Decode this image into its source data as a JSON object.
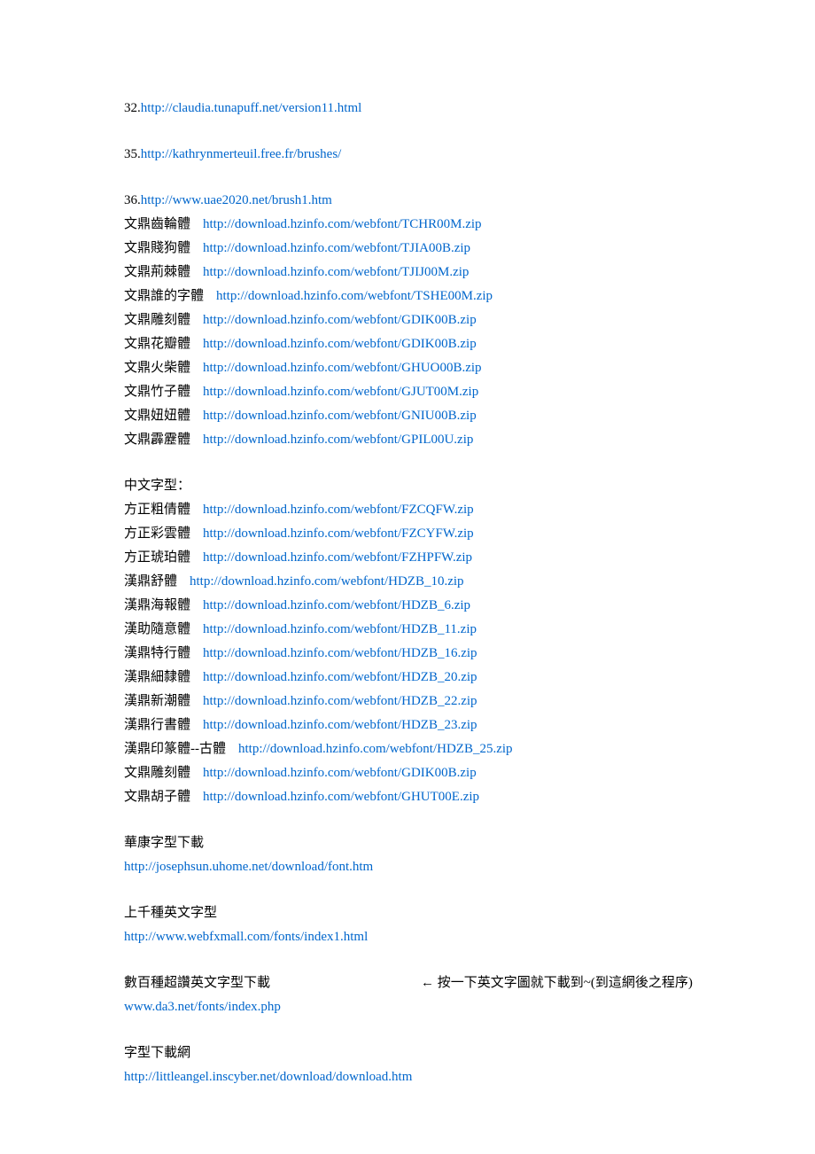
{
  "lines": {
    "l32_num": "32.",
    "l32_url": "http://claudia.tunapuff.net/version11.html",
    "l35_num": "35.",
    "l35_url": "http://kathrynmerteuil.free.fr/brushes/",
    "l36_num": "36.",
    "l36_url": "http://www.uae2020.net/brush1.htm",
    "f01_label": "文鼎齒輪體",
    "f01_url": "http://download.hzinfo.com/webfont/TCHR00M.zip",
    "f02_label": "文鼎賤狗體",
    "f02_url": "http://download.hzinfo.com/webfont/TJIA00B.zip",
    "f03_label": "文鼎荊棘體",
    "f03_url": "http://download.hzinfo.com/webfont/TJIJ00M.zip",
    "f04_label": "文鼎誰的字體",
    "f04_url": "http://download.hzinfo.com/webfont/TSHE00M.zip",
    "f05_label": "文鼎雕刻體",
    "f05_url": "http://download.hzinfo.com/webfont/GDIK00B.zip",
    "f06_label": "文鼎花瓣體",
    "f06_url": "http://download.hzinfo.com/webfont/GDIK00B.zip",
    "f07_label": "文鼎火柴體",
    "f07_url": "http://download.hzinfo.com/webfont/GHUO00B.zip",
    "f08_label": "文鼎竹子體",
    "f08_url": "http://download.hzinfo.com/webfont/GJUT00M.zip",
    "f09_label": "文鼎妞妞體",
    "f09_url": "http://download.hzinfo.com/webfont/GNIU00B.zip",
    "f10_label": "文鼎霹靂體",
    "f10_url": "http://download.hzinfo.com/webfont/GPIL00U.zip",
    "sec2_title": "中文字型：",
    "g01_label": "方正粗倩體",
    "g01_url": "http://download.hzinfo.com/webfont/FZCQFW.zip",
    "g02_label": "方正彩雲體",
    "g02_url": "http://download.hzinfo.com/webfont/FZCYFW.zip",
    "g03_label": "方正琥珀體",
    "g03_url": "http://download.hzinfo.com/webfont/FZHPFW.zip",
    "g04_label": "漢鼎舒體",
    "g04_url": "http://download.hzinfo.com/webfont/HDZB_10.zip",
    "g05_label": "漢鼎海報體",
    "g05_url": "http://download.hzinfo.com/webfont/HDZB_6.zip",
    "g06_label": "漢助隨意體",
    "g06_url": "http://download.hzinfo.com/webfont/HDZB_11.zip",
    "g07_label": "漢鼎特行體",
    "g07_url": "http://download.hzinfo.com/webfont/HDZB_16.zip",
    "g08_label": "漢鼎細隸體",
    "g08_url": "http://download.hzinfo.com/webfont/HDZB_20.zip",
    "g09_label": "漢鼎新潮體",
    "g09_url": "http://download.hzinfo.com/webfont/HDZB_22.zip",
    "g10_label": "漢鼎行書體",
    "g10_url": "http://download.hzinfo.com/webfont/HDZB_23.zip",
    "g11_label": "漢鼎印篆體--古體",
    "g11_url": "http://download.hzinfo.com/webfont/HDZB_25.zip",
    "g12_label": "文鼎雕刻體",
    "g12_url": "http://download.hzinfo.com/webfont/GDIK00B.zip",
    "g13_label": "文鼎胡子體",
    "g13_url": "http://download.hzinfo.com/webfont/GHUT00E.zip",
    "sec3_title": "華康字型下載",
    "sec3_url": "http://josephsun.uhome.net/download/font.htm",
    "sec4_title": "上千種英文字型",
    "sec4_url": "http://www.webfxmall.com/fonts/index1.html",
    "sec5_title": "數百種超讚英文字型下載",
    "sec5_note": "← 按一下英文字圖就下載到~(到這網後之程序)",
    "sec5_url": "www.da3.net/fonts/index.php",
    "sec6_title": "字型下載網",
    "sec6_url": "http://littleangel.inscyber.net/download/download.htm"
  }
}
